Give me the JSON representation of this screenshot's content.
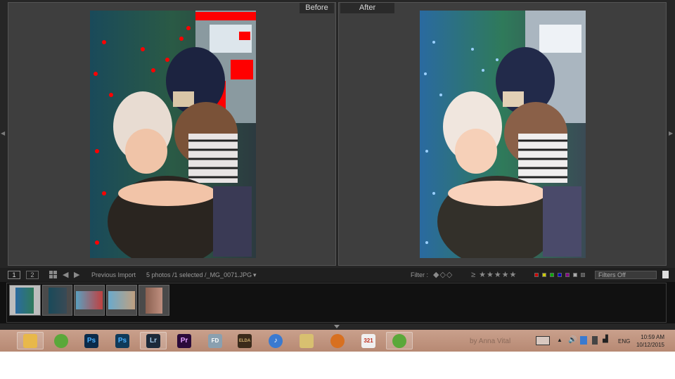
{
  "compare": {
    "before_label": "Before",
    "after_label": "After"
  },
  "toolbar": {
    "view1": "1",
    "view2": "2",
    "source": "Previous Import",
    "photo_info": "5 photos /1 selected /_MG_0071.JPG",
    "filter_label": "Filter :",
    "rating_stars": "≥ ★★★★★",
    "filters_select": "Filters Off"
  },
  "filmstrip": {
    "thumbnail_count": 5,
    "selected_index": 0
  },
  "taskbar": {
    "apps": [
      {
        "name": "file-explorer",
        "label": "",
        "color": "#e8b84a"
      },
      {
        "name": "cyberlink",
        "label": "",
        "color": "#5aa83a"
      },
      {
        "name": "photoshop",
        "label": "Ps",
        "color": "#0a2a4a"
      },
      {
        "name": "photoshop-cc",
        "label": "Ps",
        "color": "#0f3a5a"
      },
      {
        "name": "lightroom",
        "label": "Lr",
        "color": "#1b2a3a"
      },
      {
        "name": "premiere",
        "label": "Pr",
        "color": "#2a0a3a"
      },
      {
        "name": "fd-app",
        "label": "FD",
        "color": "#8aa0b0"
      },
      {
        "name": "eldar-game",
        "label": "ELDA",
        "color": "#3a2a1a"
      },
      {
        "name": "itunes",
        "label": "♪",
        "color": "#3a7ad0"
      },
      {
        "name": "folder-app",
        "label": "",
        "color": "#d8c070"
      },
      {
        "name": "disc-app",
        "label": "",
        "color": "#d87020"
      },
      {
        "name": "media-player",
        "label": "321",
        "color": "#f0f0f0"
      },
      {
        "name": "cyberlink-2",
        "label": "",
        "color": "#5aa83a"
      }
    ],
    "watermark": "by Anna Vital",
    "language": "ENG",
    "time": "10:59 AM",
    "date": "10/12/2015"
  },
  "colors": {
    "app_bg": "#262626",
    "panel_bg": "#3e3e3e",
    "clipping_warning": "#ff0000",
    "taskbar": "#c29a86"
  }
}
